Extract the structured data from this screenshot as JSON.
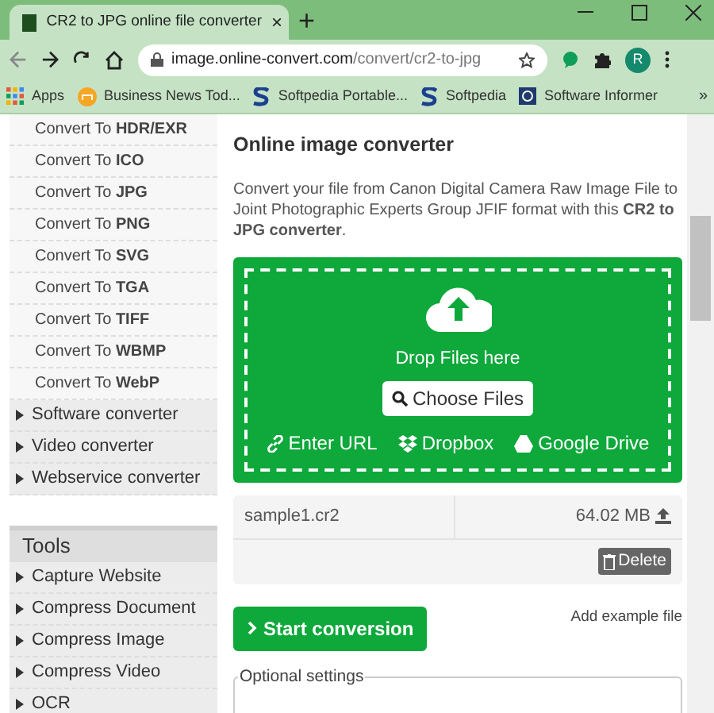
{
  "browser": {
    "tab_title": "CR2 to JPG online file converter",
    "tab_close": "×",
    "new_tab": "+",
    "url_host": "image.online-convert.com",
    "url_path": "/convert/cr2-to-jpg",
    "profile_initial": "R",
    "bookmarks": [
      {
        "label": "Apps",
        "kind": "apps"
      },
      {
        "label": "Business News Tod...",
        "kind": "news"
      },
      {
        "label": "Softpedia Portable...",
        "kind": "softpedia"
      },
      {
        "label": "Softpedia",
        "kind": "softpedia"
      },
      {
        "label": "Software Informer",
        "kind": "informer"
      }
    ],
    "more": "»"
  },
  "sidebar": {
    "items": [
      {
        "kind": "format",
        "label": "Convert To **HDR/EXR**"
      },
      {
        "kind": "format",
        "label": "Convert To **ICO**"
      },
      {
        "kind": "format",
        "label": "Convert To **JPG**"
      },
      {
        "kind": "format",
        "label": "Convert To **PNG**"
      },
      {
        "kind": "format",
        "label": "Convert To **SVG**"
      },
      {
        "kind": "format",
        "label": "Convert To **TGA**"
      },
      {
        "kind": "format",
        "label": "Convert To **TIFF**"
      },
      {
        "kind": "format",
        "label": "Convert To **WBMP**"
      },
      {
        "kind": "format",
        "label": "Convert To **WebP**"
      },
      {
        "kind": "category",
        "label": "Software converter"
      },
      {
        "kind": "category",
        "label": "Video converter"
      },
      {
        "kind": "category",
        "label": "Webservice converter"
      }
    ],
    "tools_title": "Tools",
    "tools": [
      "Capture Website",
      "Compress Document",
      "Compress Image",
      "Compress Video",
      "OCR"
    ]
  },
  "main": {
    "title": "Online image converter",
    "description": "Convert your file from Canon Digital Camera Raw Image File to Joint Photographic Experts Group JFIF format with this **CR2 to JPG converter**.",
    "drop_text": "Drop Files here",
    "choose_button": "Choose Files",
    "sources": [
      {
        "kind": "url",
        "label": "Enter URL"
      },
      {
        "kind": "dropbox",
        "label": "Dropbox"
      },
      {
        "kind": "drive",
        "label": "Google Drive"
      }
    ],
    "file": {
      "name": "sample1.cr2",
      "size": "64.02 MB",
      "delete": "Delete"
    },
    "start_button": "Start conversion",
    "example_link": "Add example file",
    "optional_settings": "Optional settings"
  }
}
